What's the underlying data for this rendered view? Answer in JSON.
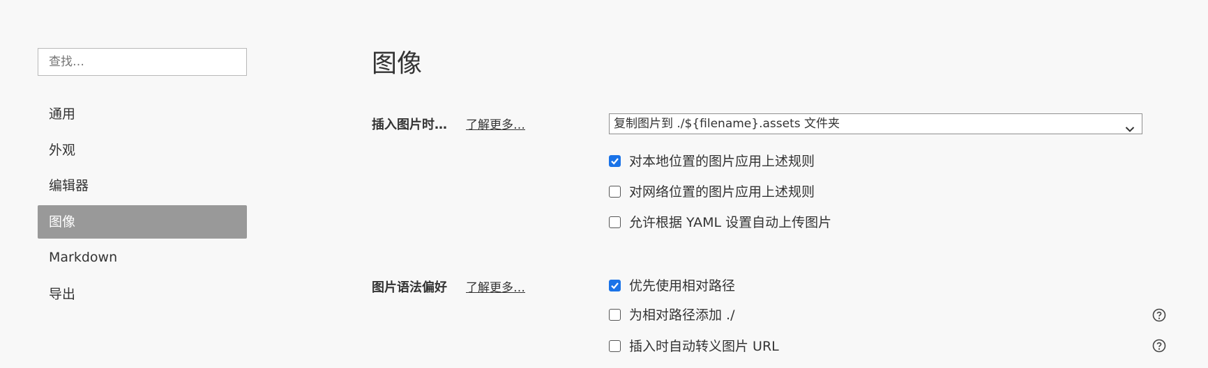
{
  "sidebar": {
    "search_placeholder": "查找…",
    "items": [
      {
        "label": "通用",
        "active": false
      },
      {
        "label": "外观",
        "active": false
      },
      {
        "label": "编辑器",
        "active": false
      },
      {
        "label": "图像",
        "active": true
      },
      {
        "label": "Markdown",
        "active": false
      },
      {
        "label": "导出",
        "active": false
      }
    ]
  },
  "main": {
    "title": "图像",
    "insert_section": {
      "label": "插入图片时…",
      "learn_more": "了解更多…",
      "select_value": "复制图片到 ./${filename}.assets 文件夹",
      "options": [
        {
          "label": "对本地位置的图片应用上述规则",
          "checked": true
        },
        {
          "label": "对网络位置的图片应用上述规则",
          "checked": false
        },
        {
          "label": "允许根据 YAML 设置自动上传图片",
          "checked": false
        }
      ]
    },
    "syntax_section": {
      "label": "图片语法偏好",
      "learn_more": "了解更多…",
      "options": [
        {
          "label": "优先使用相对路径",
          "checked": true,
          "help": false
        },
        {
          "label": "为相对路径添加 ./",
          "checked": false,
          "help": true
        },
        {
          "label": "插入时自动转义图片 URL",
          "checked": false,
          "help": true
        }
      ]
    }
  },
  "colors": {
    "accent": "#1a73e8",
    "active_nav": "#999999",
    "background": "#f8f8f8"
  },
  "icons": {
    "dropdown": "chevron-down-icon",
    "help": "help-circle-icon",
    "checkmark": "checkmark-icon"
  }
}
